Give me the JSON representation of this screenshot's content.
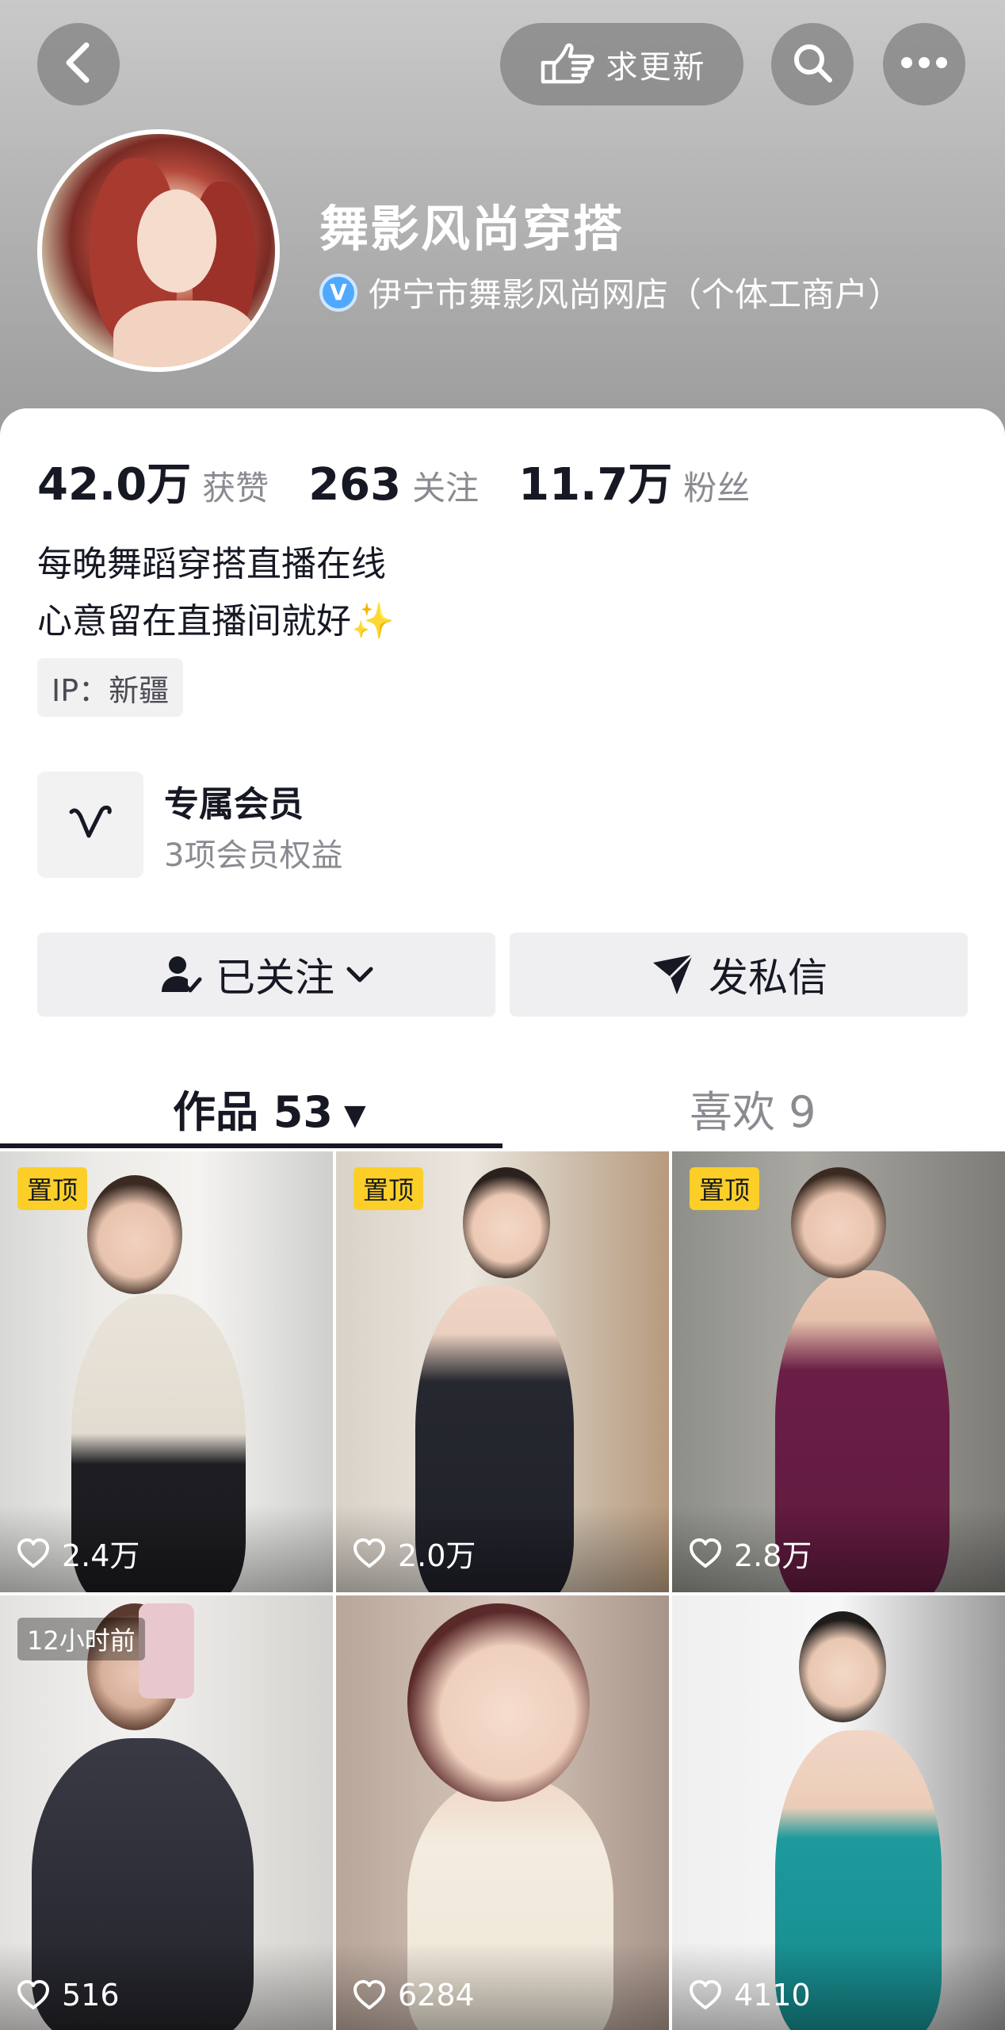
{
  "header": {
    "request_update_label": "求更新",
    "account_name": "舞影风尚穿搭",
    "verified_text": "伊宁市舞影风尚网店（个体工商户）",
    "verified_badge": "V"
  },
  "stats": [
    {
      "value": "42.0万",
      "label": "获赞"
    },
    {
      "value": "263",
      "label": "关注"
    },
    {
      "value": "11.7万",
      "label": "粉丝"
    }
  ],
  "bio": {
    "line1": "每晚舞蹈穿搭直播在线",
    "line2": "心意留在直播间就好",
    "sparkle": "✨"
  },
  "ip_label": "IP：新疆",
  "membership": {
    "title": "专属会员",
    "subtitle": "3项会员权益"
  },
  "actions": {
    "follow_label": "已关注",
    "message_label": "发私信"
  },
  "tabs": {
    "works_label": "作品 53",
    "works_caret": "▼",
    "likes_label": "喜欢 9"
  },
  "grid": [
    {
      "badge": "置顶",
      "badge_type": "pinned",
      "likes": "2.4万"
    },
    {
      "badge": "置顶",
      "badge_type": "pinned",
      "likes": "2.0万"
    },
    {
      "badge": "置顶",
      "badge_type": "pinned",
      "likes": "2.8万"
    },
    {
      "badge": "12小时前",
      "badge_type": "time",
      "likes": "516"
    },
    {
      "badge": "",
      "badge_type": "none",
      "likes": "6284"
    },
    {
      "badge": "",
      "badge_type": "none",
      "likes": "4110"
    }
  ],
  "icons": {
    "back": "chevron-left-icon",
    "request": "pointing-hand-icon",
    "search": "search-icon",
    "more": "more-dots-icon",
    "member": "vip-v-icon",
    "follow": "user-check-icon",
    "message": "send-icon",
    "like": "heart-outline-icon"
  },
  "colors": {
    "pinned_badge": "#fbcf28",
    "verified": "#4fa9ff",
    "text_primary": "#161823",
    "text_secondary": "#8a8b91"
  }
}
